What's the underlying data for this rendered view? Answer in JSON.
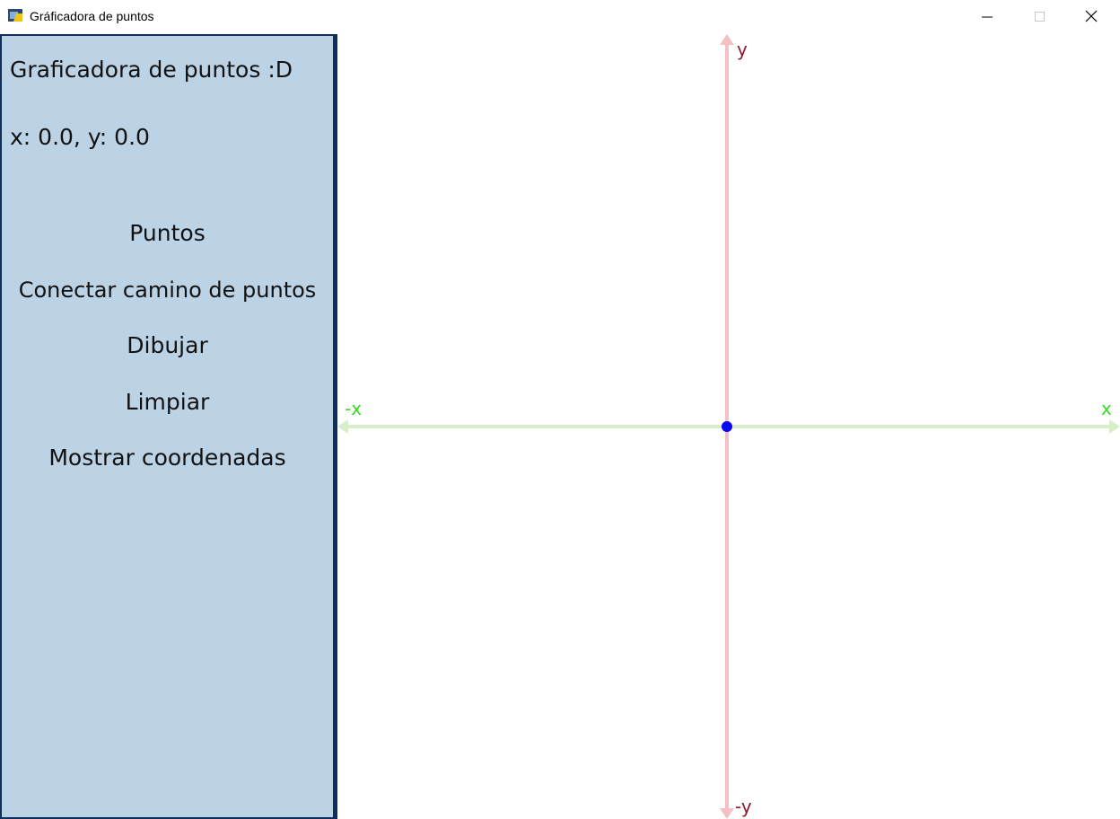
{
  "window": {
    "title": "Gráficadora de puntos"
  },
  "panel": {
    "title": "Graficadora de puntos :D",
    "coords_readout": "x: 0.0, y: 0.0",
    "menu": [
      {
        "label": "Puntos"
      },
      {
        "label": "Conectar camino de puntos"
      },
      {
        "label": "Dibujar"
      },
      {
        "label": "Limpiar"
      },
      {
        "label": "Mostrar coordenadas"
      }
    ]
  },
  "plane": {
    "labels": {
      "y": "y",
      "neg_y": "-y",
      "x": "x",
      "neg_x": "-x"
    },
    "origin_point": {
      "x": 0.0,
      "y": 0.0
    },
    "colors": {
      "y_axis": "#f3c0c3",
      "x_axis": "#d6efc9",
      "point": "#0a0aee",
      "panel_bg": "#bcd3e6",
      "panel_border": "#0f2e5c"
    }
  }
}
